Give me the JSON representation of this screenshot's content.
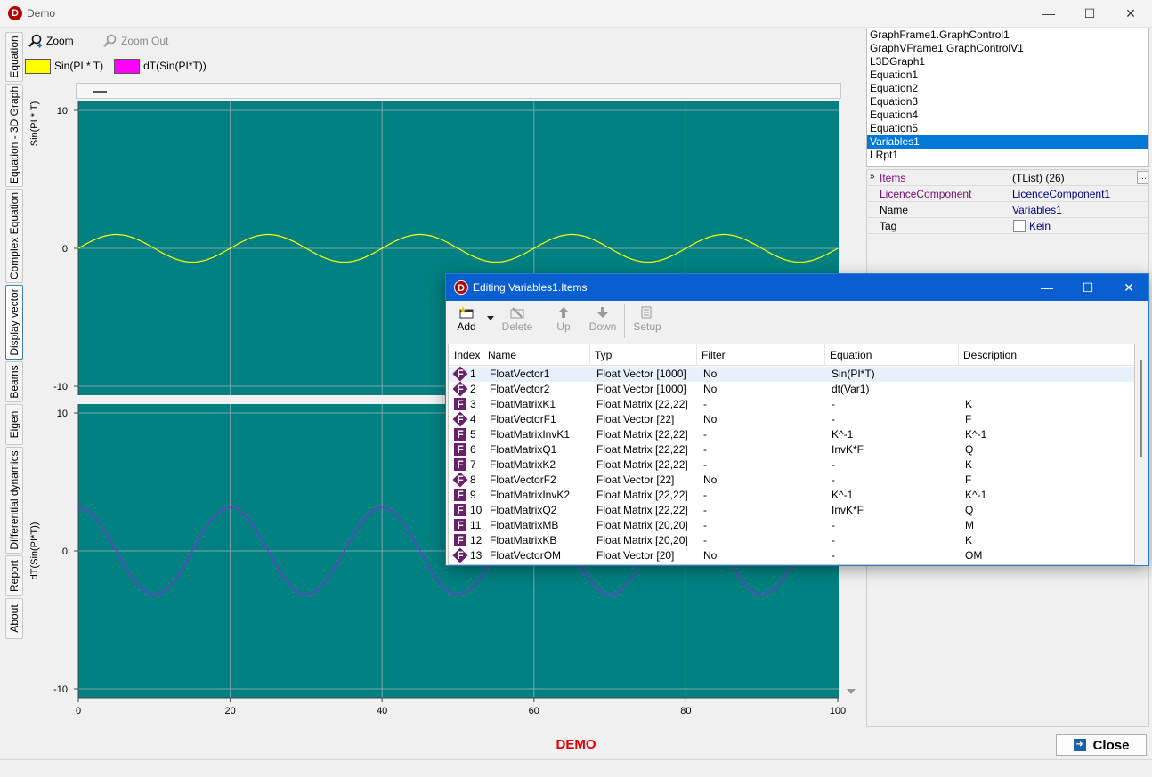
{
  "window": {
    "title": "Demo",
    "logo_letter": "D",
    "minimize": "—",
    "maximize": "☐",
    "close": "✕"
  },
  "left_tabs": [
    {
      "label": "Equation"
    },
    {
      "label": "Equation - 3D Graph"
    },
    {
      "label": "Complex Equation"
    },
    {
      "label": "Display vector"
    },
    {
      "label": "Beams"
    },
    {
      "label": "Eigen"
    },
    {
      "label": "Differential dynamics"
    },
    {
      "label": "Report"
    },
    {
      "label": "About"
    }
  ],
  "active_tab": "Display vector",
  "toolbar": {
    "zoom_label": "Zoom",
    "zoom_out_label": "Zoom Out"
  },
  "legend": [
    {
      "label": "Sin(PI * T)",
      "color": "#ffff00"
    },
    {
      "label": "dT(Sin(PI*T))",
      "color": "#ff00ff"
    }
  ],
  "chart_data": [
    {
      "type": "line",
      "background": "#008080",
      "series": [
        {
          "name": "Sin(PI * T)",
          "color": "#ffff00",
          "amplitude": 1,
          "period": 20
        }
      ],
      "x_range": [
        0,
        100
      ],
      "ylim": [
        -10,
        10
      ],
      "y_ticks": [
        "10",
        "0",
        "-10"
      ],
      "ylabel": "Sin(PI * T)",
      "grid": true
    },
    {
      "type": "line",
      "background": "#008080",
      "series": [
        {
          "name": "dT(Sin(PI*T))",
          "color": "#8a2be2",
          "amplitude": 3.14,
          "period": 20
        }
      ],
      "x_range": [
        0,
        100
      ],
      "ylim": [
        -10,
        10
      ],
      "y_ticks": [
        "10",
        "0",
        "-10"
      ],
      "x_ticks": [
        "0",
        "20",
        "40",
        "60",
        "80",
        "100"
      ],
      "ylabel": "dT(Sin(PI*T))",
      "grid": true
    }
  ],
  "components": [
    "GraphFrame1.GraphControl1",
    "GraphVFrame1.GraphControlV1",
    "L3DGraph1",
    "Equation1",
    "Equation2",
    "Equation3",
    "Equation4",
    "Equation5",
    "Variables1",
    "LRpt1"
  ],
  "selected_component": "Variables1",
  "inspector": {
    "rows": [
      {
        "name": "Items",
        "value": "(TList) (26)"
      },
      {
        "name": "LicenceComponent",
        "value": "LicenceComponent1"
      },
      {
        "name": "Name",
        "value": "Variables1"
      },
      {
        "name": "Tag",
        "value": "Kein"
      }
    ],
    "expand_marker": "»",
    "dropdown_marker": "…"
  },
  "demo_label": "DEMO",
  "close_button": "Close",
  "dialog": {
    "title": "Editing Variables1.Items",
    "toolbar": {
      "add": "Add",
      "delete": "Delete",
      "up": "Up",
      "down": "Down",
      "setup": "Setup"
    },
    "columns": [
      "Index",
      "Name",
      "Typ",
      "Filter",
      "Equation",
      "Description"
    ],
    "rows": [
      {
        "icon": "diamond",
        "index": "1",
        "name": "FloatVector1",
        "typ": "Float Vector [1000]",
        "filter": "No",
        "equation": "Sin(PI*T)",
        "description": ""
      },
      {
        "icon": "diamond",
        "index": "2",
        "name": "FloatVector2",
        "typ": "Float Vector [1000]",
        "filter": "No",
        "equation": "dt(Var1)",
        "description": ""
      },
      {
        "icon": "square",
        "index": "3",
        "name": "FloatMatrixK1",
        "typ": "Float Matrix [22,22]",
        "filter": "-",
        "equation": "-",
        "description": "K"
      },
      {
        "icon": "diamond",
        "index": "4",
        "name": "FloatVectorF1",
        "typ": "Float Vector [22]",
        "filter": "No",
        "equation": "-",
        "description": "F"
      },
      {
        "icon": "square",
        "index": "5",
        "name": "FloatMatrixInvK1",
        "typ": "Float Matrix [22,22]",
        "filter": "-",
        "equation": "K^-1",
        "description": "K^-1"
      },
      {
        "icon": "square",
        "index": "6",
        "name": "FloatMatrixQ1",
        "typ": "Float Matrix [22,22]",
        "filter": "-",
        "equation": "InvK*F",
        "description": "Q"
      },
      {
        "icon": "square",
        "index": "7",
        "name": "FloatMatrixK2",
        "typ": "Float Matrix [22,22]",
        "filter": "-",
        "equation": "-",
        "description": "K"
      },
      {
        "icon": "diamond",
        "index": "8",
        "name": "FloatVectorF2",
        "typ": "Float Vector [22]",
        "filter": "No",
        "equation": "-",
        "description": "F"
      },
      {
        "icon": "square",
        "index": "9",
        "name": "FloatMatrixInvK2",
        "typ": "Float Matrix [22,22]",
        "filter": "-",
        "equation": "K^-1",
        "description": "K^-1"
      },
      {
        "icon": "square",
        "index": "10",
        "name": "FloatMatrixQ2",
        "typ": "Float Matrix [22,22]",
        "filter": "-",
        "equation": "InvK*F",
        "description": "Q"
      },
      {
        "icon": "square",
        "index": "11",
        "name": "FloatMatrixMB",
        "typ": "Float Matrix [20,20]",
        "filter": "-",
        "equation": "-",
        "description": "M"
      },
      {
        "icon": "square",
        "index": "12",
        "name": "FloatMatrixKB",
        "typ": "Float Matrix [20,20]",
        "filter": "-",
        "equation": "-",
        "description": "K"
      },
      {
        "icon": "diamond",
        "index": "13",
        "name": "FloatVectorOM",
        "typ": "Float Vector [20]",
        "filter": "No",
        "equation": "-",
        "description": "OM"
      }
    ]
  }
}
